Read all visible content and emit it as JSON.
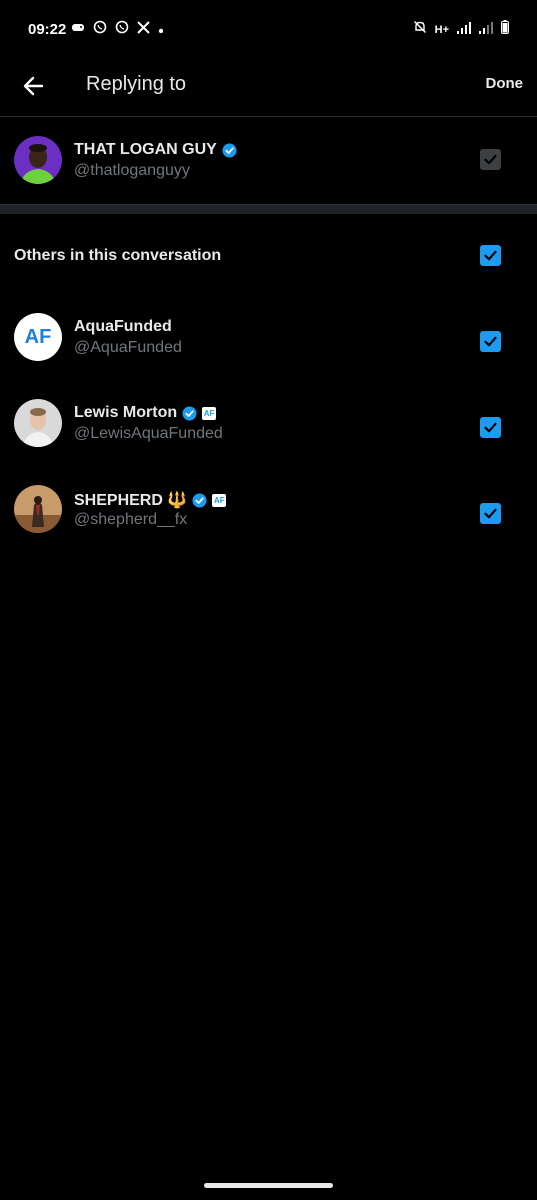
{
  "status_bar": {
    "time": "09:22",
    "network": "H+"
  },
  "header": {
    "title": "Replying to",
    "done_label": "Done"
  },
  "primary": {
    "name": "THAT LOGAN GUY",
    "handle": "@thatloganguyy",
    "checked": true,
    "disabled": true
  },
  "others": {
    "section_title": "Others in this conversation",
    "all_checked": true,
    "users": [
      {
        "name": "AquaFunded",
        "handle": "@AquaFunded",
        "verified": false,
        "affiliate": false,
        "checked": true
      },
      {
        "name": "Lewis Morton",
        "handle": "@LewisAquaFunded",
        "verified": true,
        "affiliate": true,
        "checked": true
      },
      {
        "name": "SHEPHERD 🔱",
        "handle": "@shepherd__fx",
        "verified": true,
        "affiliate": true,
        "checked": true
      }
    ]
  },
  "affiliate_badge_text": "AF",
  "aquafunded_logo_text": "AF",
  "colors": {
    "accent": "#1d9bf0",
    "background": "#000000",
    "muted_text": "#71767b"
  }
}
